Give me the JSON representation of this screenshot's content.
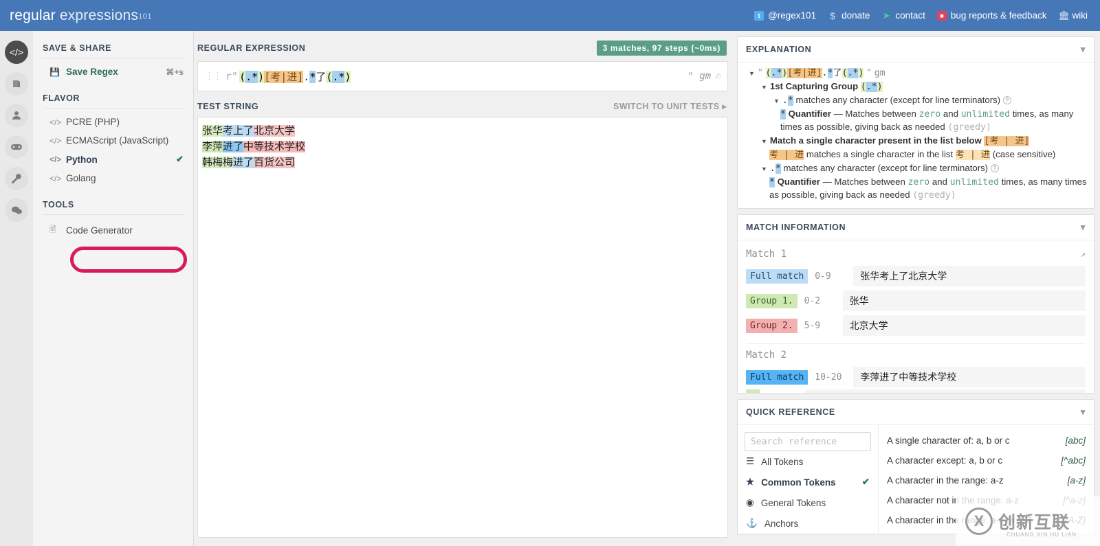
{
  "header": {
    "brand_bold": "regular",
    "brand_light": " expressions",
    "brand_sup": "101",
    "nav": [
      {
        "icon": "twitter-icon",
        "label": "@regex101"
      },
      {
        "icon": "dollar-icon",
        "label": "donate"
      },
      {
        "icon": "paper-plane-icon",
        "label": "contact"
      },
      {
        "icon": "bug-icon",
        "label": "bug reports & feedback"
      },
      {
        "icon": "bank-icon",
        "label": "wiki"
      }
    ]
  },
  "rail": [
    {
      "name": "code-icon",
      "glyph": "</>",
      "active": true
    },
    {
      "name": "library-icon",
      "glyph": "◧",
      "active": false
    },
    {
      "name": "account-icon",
      "glyph": "♟",
      "active": false
    },
    {
      "name": "gamepad-icon",
      "glyph": "⊞",
      "active": false
    },
    {
      "name": "wrench-icon",
      "glyph": "⛏",
      "active": false
    },
    {
      "name": "chat-icon",
      "glyph": "●",
      "active": false
    }
  ],
  "sidebar": {
    "save_share_title": "SAVE & SHARE",
    "save_regex_label": "Save Regex",
    "save_regex_shortcut": "⌘+s",
    "flavor_title": "FLAVOR",
    "flavors": [
      {
        "label": "PCRE (PHP)",
        "selected": false
      },
      {
        "label": "ECMAScript (JavaScript)",
        "selected": false
      },
      {
        "label": "Python",
        "selected": true
      },
      {
        "label": "Golang",
        "selected": false
      }
    ],
    "tools_title": "TOOLS",
    "tools": [
      {
        "label": "Code Generator",
        "highlighted": true
      }
    ],
    "annotation_color": "#d81b60"
  },
  "center": {
    "regex_label": "REGULAR EXPRESSION",
    "match_badge": "3 matches, 97 steps (~0ms)",
    "regex_prefix": "r\"",
    "regex_suffix": "\"",
    "regex_tokens": [
      {
        "text": "(",
        "type": "group"
      },
      {
        "text": ".",
        "type": "dot"
      },
      {
        "text": "*",
        "type": "dot"
      },
      {
        "text": ")",
        "type": "group"
      },
      {
        "text": "[考|进]",
        "type": "class"
      },
      {
        "text": ".",
        "type": "plain"
      },
      {
        "text": "*",
        "type": "dot"
      },
      {
        "text": "了",
        "type": "plain"
      },
      {
        "text": "(",
        "type": "group"
      },
      {
        "text": ".",
        "type": "dot"
      },
      {
        "text": "*",
        "type": "dot"
      },
      {
        "text": ")",
        "type": "group"
      }
    ],
    "regex_plain": "r\"(.*)[考|进].*了(.*)\"",
    "flags": "gm",
    "test_label": "TEST STRING",
    "switch_unit_tests": "SWITCH TO UNIT TESTS ▸",
    "test_lines": [
      {
        "g1": "张华",
        "mid": "考上了",
        "g2": "北京大学",
        "hover": false
      },
      {
        "g1": "李萍",
        "mid": "进了",
        "g2": "中等技术学校",
        "hover": true
      },
      {
        "g1": "韩梅梅",
        "mid": "进了",
        "g2": "百货公司",
        "hover": false
      }
    ]
  },
  "explanation": {
    "title": "EXPLANATION",
    "root_prefix": "\"",
    "root_suffix": "\"",
    "root_flags": "gm",
    "nodes": [
      {
        "label": "1st Capturing Group",
        "token": "(.*)",
        "children": [
          {
            "token": ".*",
            "text": "matches any character (except for line terminators)"
          },
          {
            "quant_token": "*",
            "bold": "Quantifier",
            "text": "— Matches between ",
            "a": "zero",
            "mid": " and ",
            "b": "unlimited",
            "tail": " times, as many times as possible, giving back as needed ",
            "greedy": "(greedy)"
          }
        ]
      },
      {
        "label": "Match a single character present in the list below",
        "token": "[考 | 进]",
        "detail_token": "考 | 进",
        "detail_text": " matches a single character in the list ",
        "detail_token2": "考 | 进",
        "detail_tail": " (case sensitive)"
      },
      {
        "token": ".*",
        "text": "matches any character (except for line terminators)",
        "quant_token": "*",
        "bold": "Quantifier",
        "quant_text": "— Matches between ",
        "a": "zero",
        "mid": " and ",
        "b": "unlimited",
        "tail": " times, as many times as possible, giving back as needed ",
        "greedy": "(greedy)"
      }
    ]
  },
  "match_information": {
    "title": "MATCH INFORMATION",
    "matches": [
      {
        "title": "Match 1",
        "rows": [
          {
            "tag": "Full match",
            "tag_type": "full",
            "range": "0-9",
            "value": "张华考上了北京大学"
          },
          {
            "tag": "Group 1.",
            "tag_type": "g1",
            "range": "0-2",
            "value": "张华"
          },
          {
            "tag": "Group 2.",
            "tag_type": "g2",
            "range": "5-9",
            "value": "北京大学"
          }
        ]
      },
      {
        "title": "Match 2",
        "rows": [
          {
            "tag": "Full match",
            "tag_type": "full-hl",
            "range": "10-20",
            "value": "李萍进了中等技术学校"
          }
        ]
      }
    ]
  },
  "quick_reference": {
    "title": "QUICK REFERENCE",
    "search_placeholder": "Search reference",
    "search_value": "",
    "categories": [
      {
        "icon": "stack-icon",
        "label": "All Tokens",
        "selected": false
      },
      {
        "icon": "star-icon",
        "label": "Common Tokens",
        "selected": true
      },
      {
        "icon": "target-icon",
        "label": "General Tokens",
        "selected": false
      },
      {
        "icon": "anchor-icon",
        "label": "Anchors",
        "selected": false
      }
    ],
    "rows": [
      {
        "desc": "A single character of: a, b or c",
        "token": "[abc]"
      },
      {
        "desc": "A character except: a, b or c",
        "token": "[^abc]"
      },
      {
        "desc": "A character in the range: a-z",
        "token": "[a-z]"
      },
      {
        "desc": "A character not in the range: a-z",
        "token": "[^a-z]"
      },
      {
        "desc": "A character in the range: a-z or A-Z",
        "token": "[a-zA-Z]"
      }
    ]
  },
  "watermark": {
    "mark": "X",
    "text": "创新互联",
    "sub": "CHUANG XIN HU LIAN"
  }
}
